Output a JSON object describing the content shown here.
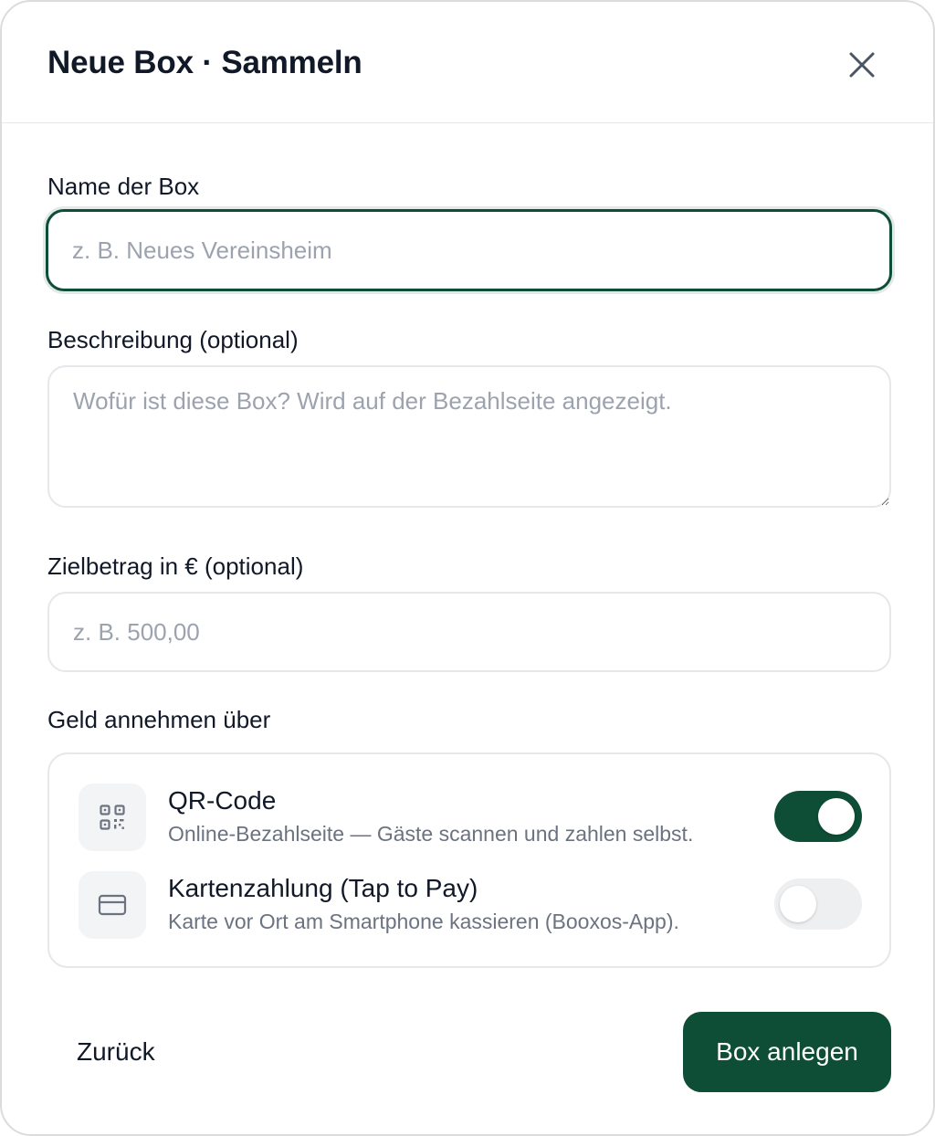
{
  "dialog": {
    "title": "Neue Box · Sammeln",
    "close_icon": "close-icon"
  },
  "form": {
    "name": {
      "label": "Name der Box",
      "placeholder": "z. B. Neues Vereinsheim",
      "value": ""
    },
    "description": {
      "label": "Beschreibung (optional)",
      "placeholder": "Wofür ist diese Box? Wird auf der Bezahlseite angezeigt.",
      "value": ""
    },
    "goal": {
      "label": "Zielbetrag in € (optional)",
      "placeholder": "z. B. 500,00",
      "value": ""
    }
  },
  "payment_methods": {
    "label": "Geld annehmen über",
    "items": [
      {
        "icon": "qr-code-icon",
        "title": "QR-Code",
        "description": "Online-Bezahlseite — Gäste scannen und zahlen selbst.",
        "enabled": true
      },
      {
        "icon": "credit-card-icon",
        "title": "Kartenzahlung (Tap to Pay)",
        "description": "Karte vor Ort am Smartphone kassieren (Booxos-App).",
        "enabled": false
      }
    ]
  },
  "footer": {
    "back_label": "Zurück",
    "create_label": "Box anlegen"
  },
  "colors": {
    "accent": "#0e4d36",
    "border": "#e5e7eb",
    "placeholder": "#9ca3af",
    "muted_text": "#6b7280"
  }
}
